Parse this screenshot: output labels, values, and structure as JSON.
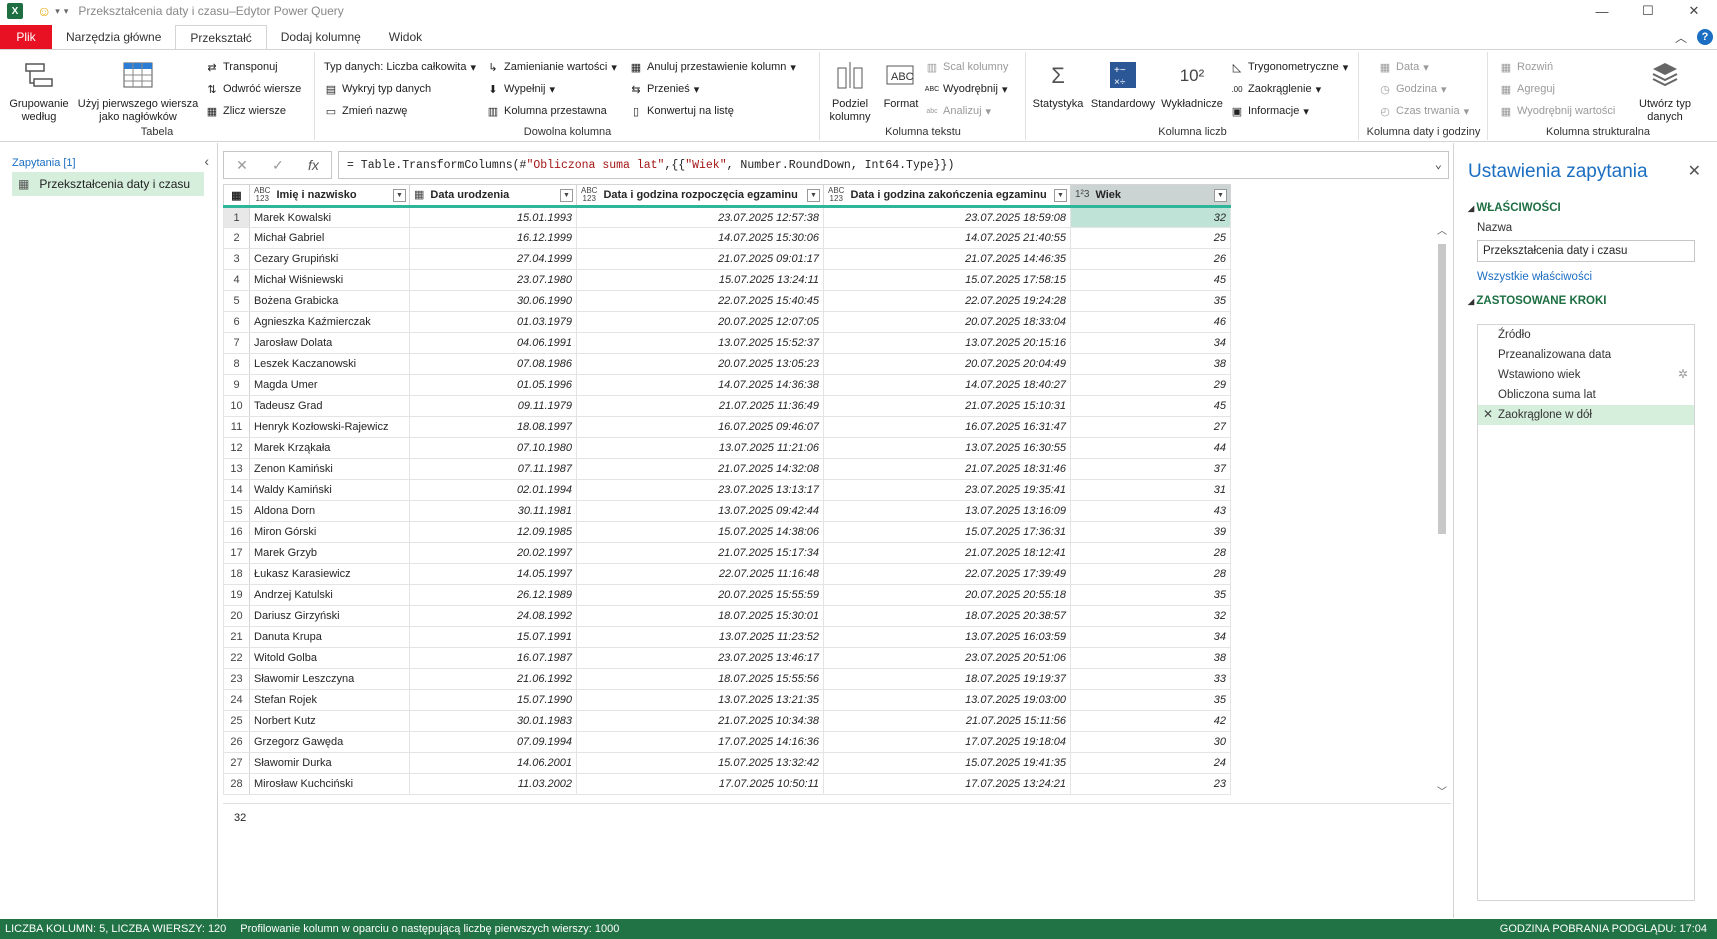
{
  "window": {
    "title": "Przekształcenia daty i czasu–Edytor Power Query"
  },
  "tabs": [
    "Plik",
    "Narzędzia główne",
    "Przekształć",
    "Dodaj kolumnę",
    "Widok"
  ],
  "ribbon": {
    "tabela": {
      "label": "Tabela",
      "grupowanie": "Grupowanie\nwedług",
      "naglowki": "Użyj pierwszego wiersza\njako nagłówków",
      "transponuj": "Transponuj",
      "odwroc": "Odwróć wiersze",
      "zlicz": "Zlicz wiersze"
    },
    "dowolna": {
      "label": "Dowolna kolumna",
      "typ": "Typ danych: Liczba całkowita",
      "wykryj": "Wykryj typ danych",
      "zmien": "Zmień nazwę",
      "zamienianie": "Zamienianie wartości",
      "wypelnij": "Wypełnij",
      "przestawna": "Kolumna przestawna",
      "anuluj": "Anuluj przestawienie kolumn",
      "przenies": "Przenieś",
      "konwertuj": "Konwertuj na listę"
    },
    "tekst": {
      "label": "Kolumna tekstu",
      "podziel": "Podziel\nkolumny",
      "format": "Format",
      "scal": "Scal kolumny",
      "wyodrebnij": "Wyodrębnij",
      "analizuj": "Analizuj"
    },
    "liczby": {
      "label": "Kolumna liczb",
      "statystyka": "Statystyka",
      "standardowy": "Standardowy",
      "wykladnicze": "Wykładnicze",
      "tryg": "Trygonometryczne",
      "zaokr": "Zaokrąglenie",
      "info": "Informacje"
    },
    "data": {
      "label": "Kolumna daty i godziny",
      "data": "Data",
      "godzina": "Godzina",
      "czas": "Czas trwania"
    },
    "strukt": {
      "label": "Kolumna strukturalna",
      "rozwin": "Rozwiń",
      "agreguj": "Agreguj",
      "wyodrebnij": "Wyodrębnij wartości",
      "utworz": "Utwórz typ\ndanych"
    }
  },
  "queries": {
    "header": "Zapytania [1]",
    "item": "Przekształcenia daty i czasu"
  },
  "formula": {
    "prefix": "= Table.TransformColumns(#",
    "s1": "\"Obliczona suma lat\"",
    "mid": ",{{",
    "s2": "\"Wiek\"",
    "suffix": ", Number.RoundDown, Int64.Type}})"
  },
  "columns": [
    {
      "name": "Imię i nazwisko",
      "type": "ABC\n123"
    },
    {
      "name": "Data urodzenia",
      "type": "date"
    },
    {
      "name": "Data i godzina rozpoczęcia egzaminu",
      "type": "ABC\n123"
    },
    {
      "name": "Data i godzina zakończenia egzaminu",
      "type": "ABC\n123"
    },
    {
      "name": "Wiek",
      "type": "1²3"
    }
  ],
  "rows": [
    [
      "Marek Kowalski",
      "15.01.1993",
      "23.07.2025 12:57:38",
      "23.07.2025 18:59:08",
      "32"
    ],
    [
      "Michał Gabriel",
      "16.12.1999",
      "14.07.2025 15:30:06",
      "14.07.2025 21:40:55",
      "25"
    ],
    [
      "Cezary Grupiński",
      "27.04.1999",
      "21.07.2025 09:01:17",
      "21.07.2025 14:46:35",
      "26"
    ],
    [
      "Michał Wiśniewski",
      "23.07.1980",
      "15.07.2025 13:24:11",
      "15.07.2025 17:58:15",
      "45"
    ],
    [
      "Bożena Grabicka",
      "30.06.1990",
      "22.07.2025 15:40:45",
      "22.07.2025 19:24:28",
      "35"
    ],
    [
      "Agnieszka Kaźmierczak",
      "01.03.1979",
      "20.07.2025 12:07:05",
      "20.07.2025 18:33:04",
      "46"
    ],
    [
      "Jarosław Dolata",
      "04.06.1991",
      "13.07.2025 15:52:37",
      "13.07.2025 20:15:16",
      "34"
    ],
    [
      "Leszek Kaczanowski",
      "07.08.1986",
      "20.07.2025 13:05:23",
      "20.07.2025 20:04:49",
      "38"
    ],
    [
      "Magda Umer",
      "01.05.1996",
      "14.07.2025 14:36:38",
      "14.07.2025 18:40:27",
      "29"
    ],
    [
      "Tadeusz Grad",
      "09.11.1979",
      "21.07.2025 11:36:49",
      "21.07.2025 15:10:31",
      "45"
    ],
    [
      "Henryk Kozłowski-Rajewicz",
      "18.08.1997",
      "16.07.2025 09:46:07",
      "16.07.2025 16:31:47",
      "27"
    ],
    [
      "Marek Krząkała",
      "07.10.1980",
      "13.07.2025 11:21:06",
      "13.07.2025 16:30:55",
      "44"
    ],
    [
      "Zenon Kamiński",
      "07.11.1987",
      "21.07.2025 14:32:08",
      "21.07.2025 18:31:46",
      "37"
    ],
    [
      "Waldy Kamiński",
      "02.01.1994",
      "23.07.2025 13:13:17",
      "23.07.2025 19:35:41",
      "31"
    ],
    [
      "Aldona Dorn",
      "30.11.1981",
      "13.07.2025 09:42:44",
      "13.07.2025 13:16:09",
      "43"
    ],
    [
      "Miron Górski",
      "12.09.1985",
      "15.07.2025 14:38:06",
      "15.07.2025 17:36:31",
      "39"
    ],
    [
      "Marek Grzyb",
      "20.02.1997",
      "21.07.2025 15:17:34",
      "21.07.2025 18:12:41",
      "28"
    ],
    [
      "Łukasz Karasiewicz",
      "14.05.1997",
      "22.07.2025 11:16:48",
      "22.07.2025 17:39:49",
      "28"
    ],
    [
      "Andrzej Katulski",
      "26.12.1989",
      "20.07.2025 15:55:59",
      "20.07.2025 20:55:18",
      "35"
    ],
    [
      "Dariusz Girzyński",
      "24.08.1992",
      "18.07.2025 15:30:01",
      "18.07.2025 20:38:57",
      "32"
    ],
    [
      "Danuta Krupa",
      "15.07.1991",
      "13.07.2025 11:23:52",
      "13.07.2025 16:03:59",
      "34"
    ],
    [
      "Witold Golba",
      "16.07.1987",
      "23.07.2025 13:46:17",
      "23.07.2025 20:51:06",
      "38"
    ],
    [
      "Sławomir Leszczyna",
      "21.06.1992",
      "18.07.2025 15:55:56",
      "18.07.2025 19:19:37",
      "33"
    ],
    [
      "Stefan Rojek",
      "15.07.1990",
      "13.07.2025 13:21:35",
      "13.07.2025 19:03:00",
      "35"
    ],
    [
      "Norbert Kutz",
      "30.01.1983",
      "21.07.2025 10:34:38",
      "21.07.2025 15:11:56",
      "42"
    ],
    [
      "Grzegorz Gawęda",
      "07.09.1994",
      "17.07.2025 14:16:36",
      "17.07.2025 19:18:04",
      "30"
    ],
    [
      "Sławomir Durka",
      "14.06.2001",
      "15.07.2025 13:32:42",
      "15.07.2025 19:41:35",
      "24"
    ],
    [
      "Mirosław Kuchciński",
      "11.03.2002",
      "17.07.2025 10:50:11",
      "17.07.2025 13:24:21",
      "23"
    ]
  ],
  "preview_value": "32",
  "settings": {
    "title": "Ustawienia zapytania",
    "props_header": "WŁAŚCIWOŚCI",
    "name_label": "Nazwa",
    "name_value": "Przekształcenia daty i czasu",
    "all_props": "Wszystkie właściwości",
    "steps_header": "ZASTOSOWANE KROKI",
    "steps": [
      "Źródło",
      "Przeanalizowana data",
      "Wstawiono wiek",
      "Obliczona suma lat",
      "Zaokrąglone w dół"
    ]
  },
  "status": {
    "left": "LICZBA KOLUMN: 5, LICZBA WIERSZY: 120",
    "profiling": "Profilowanie kolumn w oparciu o następującą liczbę pierwszych wierszy: 1000",
    "right": "GODZINA POBRANIA PODGLĄDU: 17:04"
  },
  "colors": {
    "accent_green": "#217346",
    "teal_header": "#2fb59a",
    "file_red": "#e81123",
    "link_blue": "#1b6ec2"
  }
}
